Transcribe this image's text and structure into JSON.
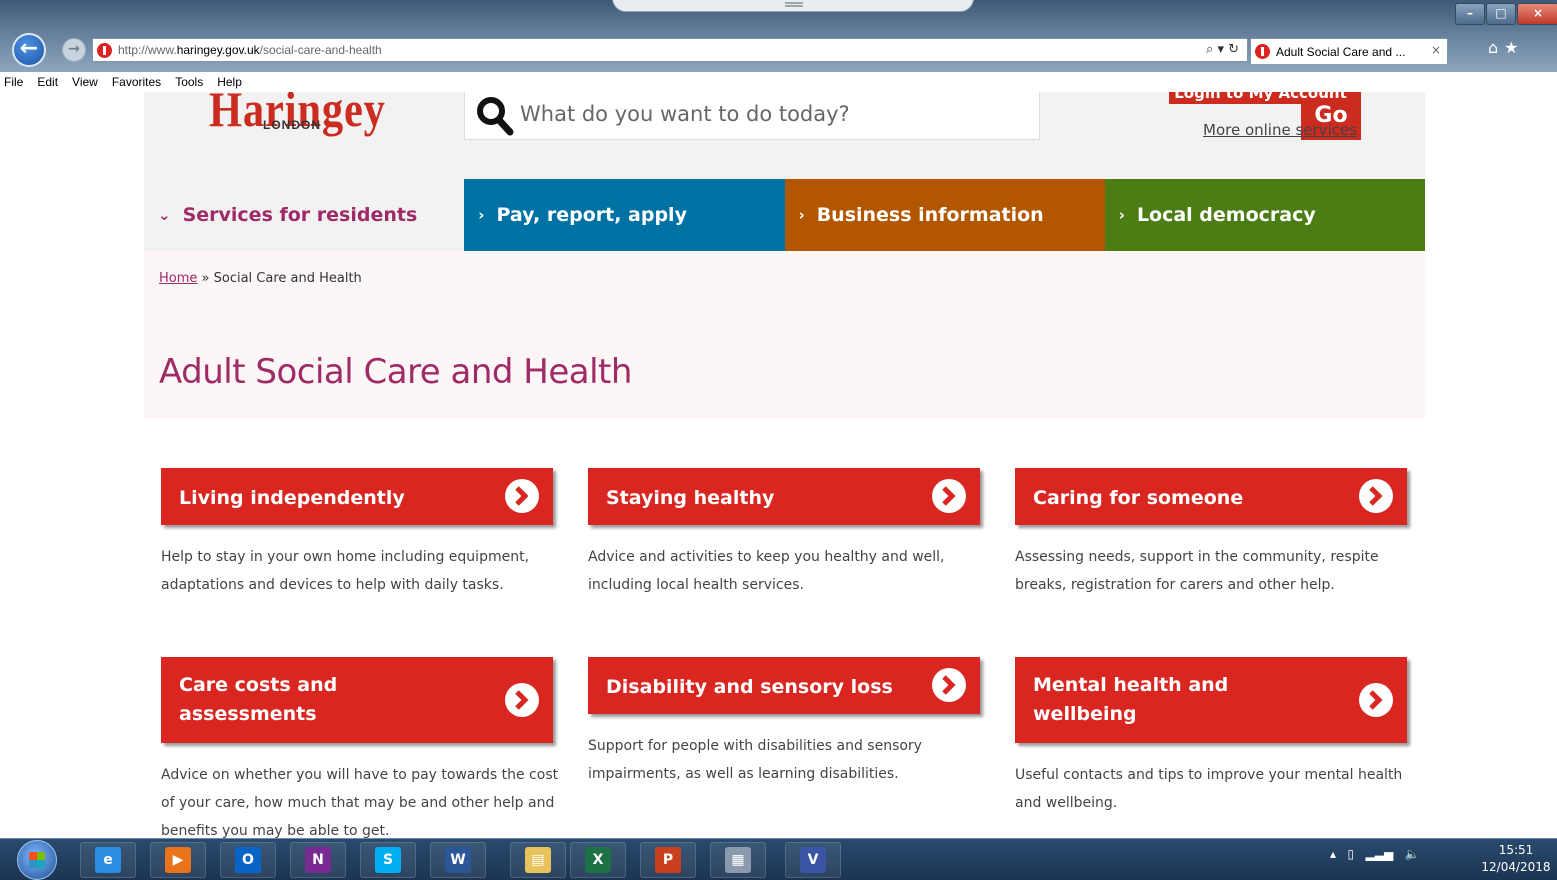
{
  "browser": {
    "url_prefix": "http://www.",
    "url_domain": "haringey.gov.uk",
    "url_path": "/social-care-and-health",
    "address_tools": "⌕ ▾ ↻",
    "tab_title": "Adult Social Care and ...",
    "tab_close": "×",
    "menu": [
      "File",
      "Edit",
      "View",
      "Favorites",
      "Tools",
      "Help"
    ]
  },
  "header": {
    "logo_text": "Haringey",
    "logo_sub": "LONDON",
    "search_placeholder": "What do you want to do today?",
    "go_label": "Go",
    "login_label": "Login to My Account",
    "more_services_label": "More online services"
  },
  "nav": [
    {
      "label": "Services for residents",
      "chevron": "⌄"
    },
    {
      "label": "Pay, report, apply",
      "chevron": "›"
    },
    {
      "label": "Business information",
      "chevron": "›"
    },
    {
      "label": "Local democracy",
      "chevron": "›"
    }
  ],
  "breadcrumb": {
    "home": "Home",
    "separator": " » ",
    "current": "Social Care and Health"
  },
  "page_title": "Adult Social Care and Health",
  "cards": [
    {
      "title": "Living independently",
      "description": "Help to stay in your own home including equipment, adaptations and devices to help with daily tasks."
    },
    {
      "title": "Staying healthy",
      "description": "Advice and activities to keep you healthy and well, including local health services."
    },
    {
      "title": "Caring for someone",
      "description": "Assessing needs, support in the community, respite breaks, registration for carers and other help."
    },
    {
      "title": "Care costs and assessments",
      "description": "Advice on whether you will have to pay towards the cost of your care, how much that may be and other help and benefits you may be able to get."
    },
    {
      "title": "Disability and sensory loss",
      "description": "Support for people with disabilities and sensory impairments, as well as learning disabilities."
    },
    {
      "title": "Mental health and wellbeing",
      "description": "Useful contacts and tips to improve your mental health and wellbeing."
    }
  ],
  "taskbar": {
    "apps": [
      {
        "icon": "internet-explorer-icon",
        "glyph": "e",
        "color": "#2a8de0"
      },
      {
        "icon": "media-player-icon",
        "glyph": "▶",
        "color": "#e8731a"
      },
      {
        "icon": "outlook-icon",
        "glyph": "O",
        "color": "#0a64c8"
      },
      {
        "icon": "onenote-icon",
        "glyph": "N",
        "color": "#7a2b93"
      },
      {
        "icon": "skype-icon",
        "glyph": "S",
        "color": "#00aff0"
      },
      {
        "icon": "word-icon",
        "glyph": "W",
        "color": "#2b5797"
      },
      {
        "icon": "file-explorer-icon",
        "glyph": "▤",
        "color": "#e8c25a"
      },
      {
        "icon": "excel-icon",
        "glyph": "X",
        "color": "#1e7145"
      },
      {
        "icon": "powerpoint-icon",
        "glyph": "P",
        "color": "#c8401e"
      },
      {
        "icon": "calculator-icon",
        "glyph": "▦",
        "color": "#8a9aac"
      },
      {
        "icon": "visio-icon",
        "glyph": "V",
        "color": "#3955a3"
      }
    ],
    "time": "15:51",
    "date": "12/04/2018"
  },
  "colors": {
    "brand_red": "#d92620",
    "brand_purple": "#9f2b66",
    "nav_blue": "#0071a3",
    "nav_orange": "#b25700",
    "nav_green": "#4c7d15"
  }
}
